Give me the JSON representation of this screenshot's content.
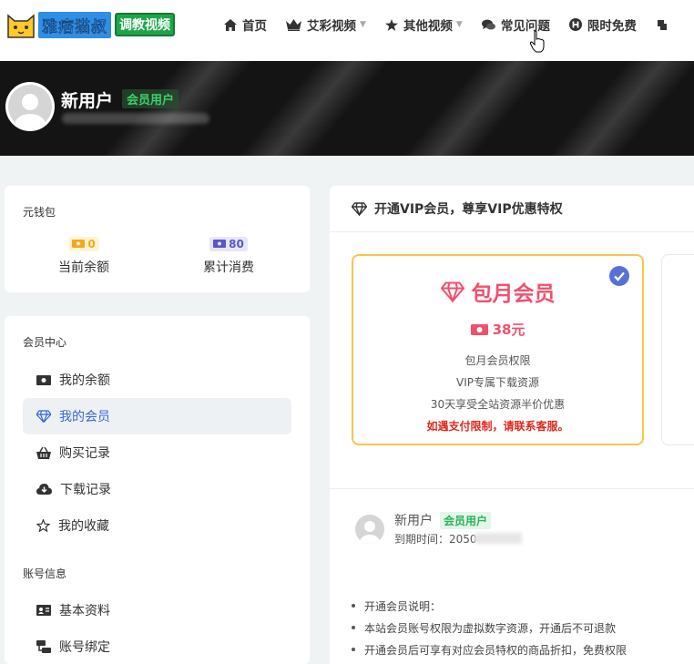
{
  "brand": {
    "name": "雅痞猫叔",
    "tag": "调教视频"
  },
  "nav": [
    {
      "label": "首页",
      "icon": "home-icon",
      "dropdown": false
    },
    {
      "label": "艾彩视频",
      "icon": "crown-icon",
      "dropdown": true
    },
    {
      "label": "其他视频",
      "icon": "star-icon",
      "dropdown": true
    },
    {
      "label": "常见问题",
      "icon": "comments-icon",
      "dropdown": false
    },
    {
      "label": "限时免费",
      "icon": "h-circle-icon",
      "dropdown": false
    }
  ],
  "profile": {
    "name": "新用户",
    "badge": "会员用户"
  },
  "wallet": {
    "title": "元钱包",
    "balance": {
      "value": "0",
      "label": "当前余额"
    },
    "spent": {
      "value": "80",
      "label": "累计消费"
    }
  },
  "member_center": {
    "title": "会员中心",
    "items": [
      {
        "label": "我的余额",
        "icon": "money-icon",
        "active": false
      },
      {
        "label": "我的会员",
        "icon": "diamond-icon",
        "active": true
      },
      {
        "label": "购买记录",
        "icon": "basket-icon",
        "active": false
      },
      {
        "label": "下载记录",
        "icon": "cloud-download-icon",
        "active": false
      },
      {
        "label": "我的收藏",
        "icon": "star-outline-icon",
        "active": false
      }
    ]
  },
  "account": {
    "title": "账号信息",
    "items": [
      {
        "label": "基本资料",
        "icon": "id-card-icon"
      },
      {
        "label": "账号绑定",
        "icon": "link-icon"
      }
    ]
  },
  "vip": {
    "heading": "开通VIP会员，尊享VIP优惠特权",
    "plan": {
      "name": "包月会员",
      "price": "38元",
      "features": [
        "包月会员权限",
        "VIP专属下载资源",
        "30天享受全站资源半价优惠"
      ],
      "warning": "如遇支付限制，请联系客服。"
    },
    "user": {
      "name": "新用户",
      "badge": "会员用户",
      "expiry_label": "到期时间：",
      "expiry_value": "2050"
    },
    "notes": [
      "开通会员说明：",
      "本站会员账号权限为虚拟数字资源，开通后不可退款",
      "开通会员后可享有对应会员特权的商品折扣，免费权限"
    ]
  },
  "colors": {
    "accent": "#3767d6",
    "price": "#f0506e",
    "plan_border": "#f7c54a",
    "badge_green": "#2bb25a"
  }
}
